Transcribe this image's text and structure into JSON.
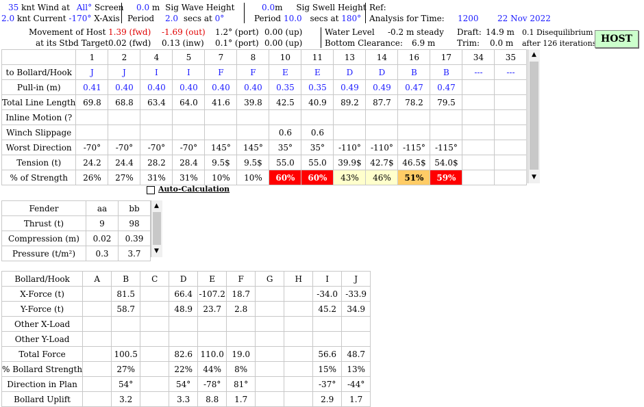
{
  "header": {
    "wind_speed": "35",
    "wind_label": "knt Wind at",
    "wind_dir": "All°",
    "wind_rel": "Screen",
    "current_speed": "2.0",
    "current_label": "knt Current",
    "current_dir": "-170°",
    "current_rel": "X-Axis",
    "sig_wave_val": "0.0",
    "sig_wave_unit": "m",
    "sig_wave_label": "Sig Wave Height",
    "wave_period_label": "Period",
    "wave_period": "2.0",
    "wave_secs": "secs at",
    "wave_dir": "0°",
    "swell_val": "0.0",
    "swell_unit": "m",
    "swell_label": "Sig Swell Height",
    "swell_period_label": "Period",
    "swell_period": "10.0",
    "swell_secs": "secs at",
    "swell_dir": "180°",
    "ref_label": "Ref:",
    "analysis_label": "Analysis for Time:",
    "analysis_time": "1200",
    "analysis_date": "22 Nov 2022"
  },
  "movement": {
    "label1": "Movement of Host",
    "label2": "at its Stbd Target",
    "r1": [
      "1.39 (fwd)",
      "-1.69 (out)",
      "1.2° (port)",
      "0.00 (up)"
    ],
    "r2": [
      "0.02 (fwd)",
      "0.13 (inw)",
      "0.1° (port)",
      "0.00 (up)"
    ],
    "water_label": "Water Level",
    "water_val": "-0.2 m steady",
    "clear_label": "Bottom Clearance:",
    "clear_val": "6.9 m",
    "draft_label": "Draft:",
    "draft_val": "14.9 m",
    "diseq": "0.1 Disequilibrium",
    "trim_label": "Trim:",
    "trim_val": "0.0 m",
    "iter": "after 126 iterations",
    "host_button": "HOST"
  },
  "lines": {
    "columns": [
      "1",
      "2",
      "4",
      "5",
      "7",
      "8",
      "10",
      "11",
      "13",
      "14",
      "16",
      "17",
      "34",
      "35"
    ],
    "rows": [
      {
        "label": "to Bollard/Hook",
        "blue": true,
        "cells": [
          "J",
          "J",
          "I",
          "I",
          "F",
          "F",
          "E",
          "E",
          "D",
          "D",
          "B",
          "B",
          "---",
          "---"
        ]
      },
      {
        "label": "Pull-in (m)",
        "blue": true,
        "cells": [
          "0.41",
          "0.40",
          "0.40",
          "0.40",
          "0.40",
          "0.40",
          "0.35",
          "0.35",
          "0.49",
          "0.49",
          "0.47",
          "0.47",
          "",
          ""
        ]
      },
      {
        "label": "Total Line Length",
        "blue": false,
        "cells": [
          "69.8",
          "68.8",
          "63.4",
          "64.0",
          "41.6",
          "39.8",
          "42.5",
          "40.9",
          "89.2",
          "87.7",
          "78.2",
          "79.5",
          "",
          ""
        ]
      },
      {
        "label": "Inline Motion (?",
        "blue": false,
        "cells": [
          "",
          "",
          "",
          "",
          "",
          "",
          "",
          "",
          "",
          "",
          "",
          "",
          "",
          ""
        ]
      },
      {
        "label": "Winch Slippage",
        "blue": false,
        "cells": [
          "",
          "",
          "",
          "",
          "",
          "",
          "0.6",
          "0.6",
          "",
          "",
          "",
          "",
          "",
          ""
        ]
      },
      {
        "label": "Worst Direction",
        "blue": false,
        "cells": [
          "-70°",
          "-70°",
          "-70°",
          "-70°",
          "145°",
          "145°",
          "35°",
          "35°",
          "-110°",
          "-110°",
          "-115°",
          "-115°",
          "",
          ""
        ]
      },
      {
        "label": "Tension (t)",
        "blue": false,
        "cells": [
          "24.2",
          "24.4",
          "28.2",
          "28.4",
          "9.5$",
          "9.5$",
          "55.0",
          "55.0",
          "39.9$",
          "42.7$",
          "46.5$",
          "54.0$",
          "",
          ""
        ]
      },
      {
        "label": "% of Strength",
        "blue": false,
        "cells": [
          "26%",
          "27%",
          "31%",
          "31%",
          "10%",
          "10%",
          "60%",
          "60%",
          "43%",
          "46%",
          "51%",
          "59%",
          "",
          ""
        ]
      }
    ],
    "strength_classes": [
      "",
      "",
      "",
      "",
      "",
      "",
      "c60",
      "c60",
      "c43",
      "c46",
      "c51",
      "c59",
      "",
      ""
    ]
  },
  "auto_calc_label": "Auto-Calculation",
  "fenders": {
    "header": [
      "Fender",
      "aa",
      "bb"
    ],
    "rows": [
      [
        "Thrust (t)",
        "9",
        "98"
      ],
      [
        "Compression (m)",
        "0.02",
        "0.39"
      ],
      [
        "Pressure (t/m²)",
        "0.3",
        "3.7"
      ]
    ]
  },
  "bollards": {
    "header": [
      "Bollard/Hook",
      "A",
      "B",
      "C",
      "D",
      "E",
      "F",
      "G",
      "H",
      "I",
      "J"
    ],
    "rows": [
      [
        "X-Force (t)",
        "",
        "81.5",
        "",
        "66.4",
        "-107.2",
        "18.7",
        "",
        "",
        "-34.0",
        "-33.9"
      ],
      [
        "Y-Force (t)",
        "",
        "58.7",
        "",
        "48.9",
        "23.7",
        "2.8",
        "",
        "",
        "45.2",
        "34.9"
      ],
      [
        "Other X-Load",
        "",
        "",
        "",
        "",
        "",
        "",
        "",
        "",
        "",
        ""
      ],
      [
        "Other Y-Load",
        "",
        "",
        "",
        "",
        "",
        "",
        "",
        "",
        "",
        ""
      ],
      [
        "Total Force",
        "",
        "100.5",
        "",
        "82.6",
        "110.0",
        "19.0",
        "",
        "",
        "56.6",
        "48.7"
      ],
      [
        "% Bollard Strength",
        "",
        "27%",
        "",
        "22%",
        "44%",
        "8%",
        "",
        "",
        "15%",
        "13%"
      ],
      [
        "Direction in Plan",
        "",
        "54°",
        "",
        "54°",
        "-78°",
        "81°",
        "",
        "",
        "-37°",
        "-44°"
      ],
      [
        "Bollard Uplift",
        "",
        "3.2",
        "",
        "3.3",
        "8.8",
        "1.7",
        "",
        "",
        "2.9",
        "1.7"
      ]
    ]
  }
}
